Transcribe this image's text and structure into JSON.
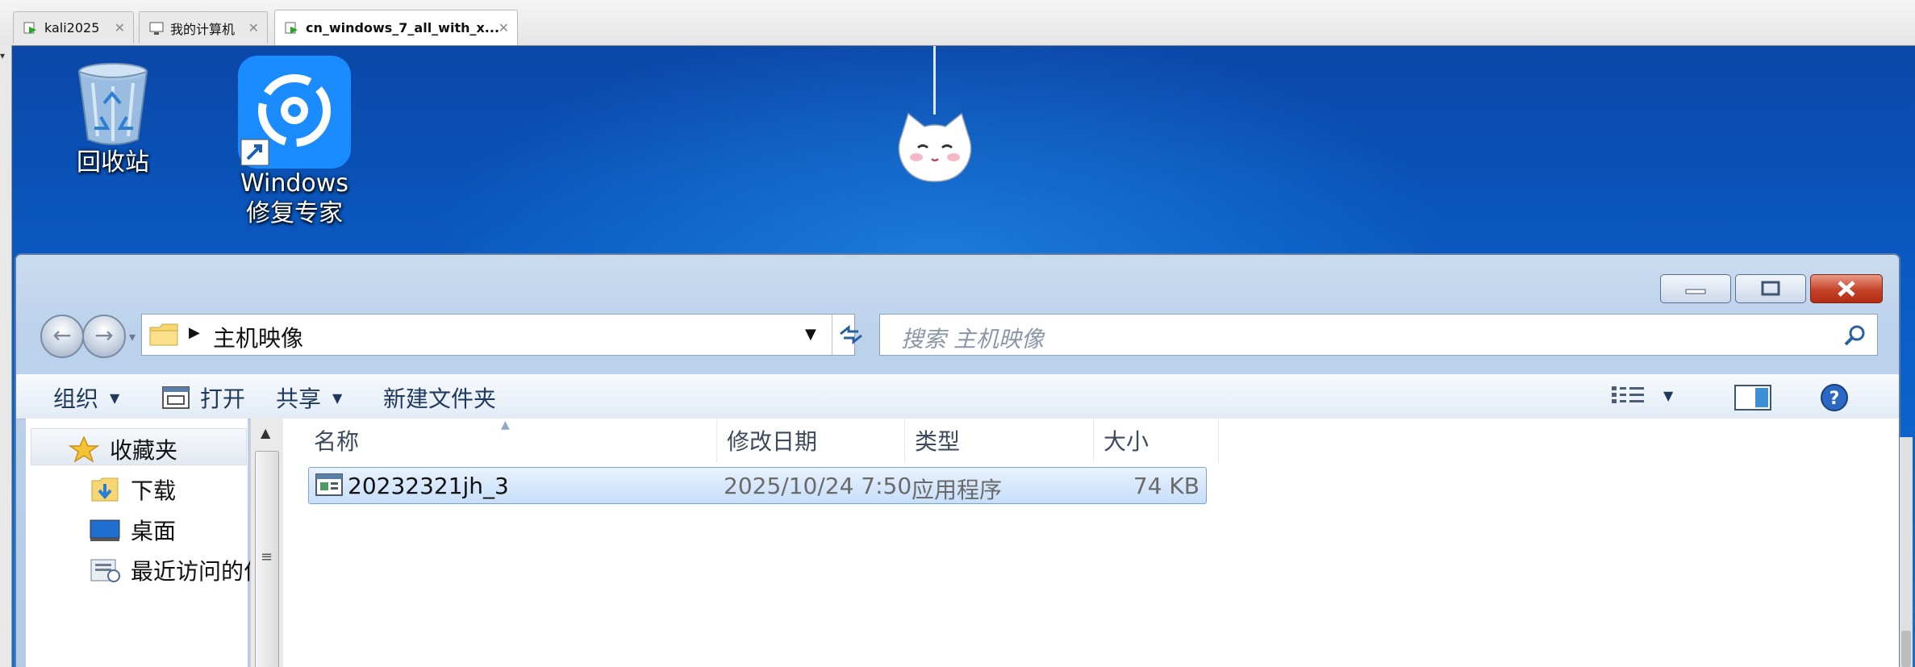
{
  "host": {
    "tabs": [
      {
        "label": "kali2025",
        "icon": "vm-running-icon"
      },
      {
        "label": "我的计算机",
        "icon": "computer-icon"
      },
      {
        "label": "cn_windows_7_all_with_x...",
        "icon": "vm-running-icon",
        "active": true
      }
    ]
  },
  "desktop": {
    "icons": [
      {
        "label": "回收站",
        "icon": "recycle-bin-icon"
      },
      {
        "label_line1": "Windows",
        "label_line2": "修复专家",
        "icon": "repair-tool-shortcut-icon"
      }
    ],
    "decoration": "hanging-cat-icon"
  },
  "explorer": {
    "address": {
      "path": "主机映像"
    },
    "search": {
      "placeholder": "搜索 主机映像"
    },
    "toolbar": {
      "organize": "组织",
      "open": "打开",
      "share": "共享",
      "new_folder": "新建文件夹"
    },
    "nav": {
      "favorites": "收藏夹",
      "items": [
        "下载",
        "桌面",
        "最近访问的位置"
      ]
    },
    "columns": {
      "name": "名称",
      "modified": "修改日期",
      "type": "类型",
      "size": "大小"
    },
    "files": [
      {
        "name": "20232321jh_3",
        "modified": "2025/10/24 7:50",
        "type": "应用程序",
        "size": "74 KB"
      }
    ]
  },
  "colors": {
    "desktop_blue": "#0a5cc4",
    "toolbar_text": "#1e395b",
    "close_red": "#c3432a",
    "selection": "#c7defa"
  }
}
